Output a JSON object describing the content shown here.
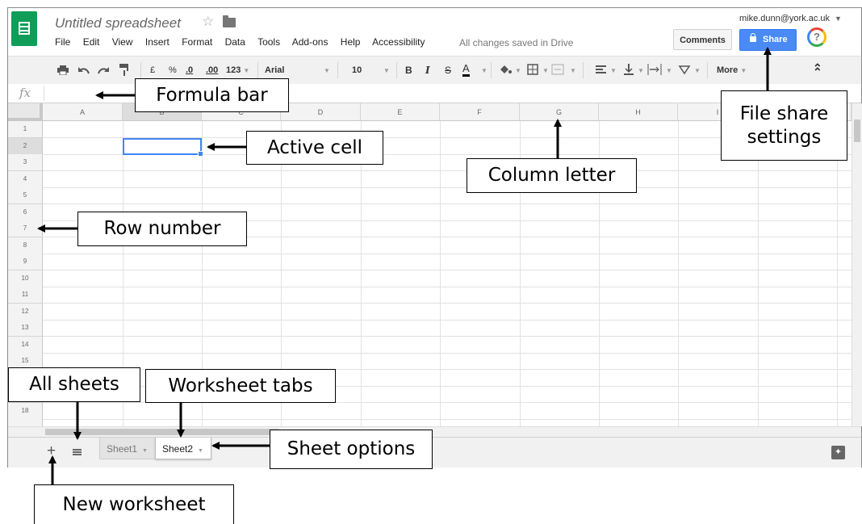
{
  "header": {
    "doc_title": "Untitled spreadsheet",
    "star_icon": "☆",
    "menu": [
      "File",
      "Edit",
      "View",
      "Insert",
      "Format",
      "Data",
      "Tools",
      "Add-ons",
      "Help",
      "Accessibility"
    ],
    "save_status": "All changes saved in Drive",
    "account": "mike.dunn@york.ac.uk",
    "comments_label": "Comments",
    "share_label": "Share",
    "help_glyph": "?"
  },
  "toolbar": {
    "currency": "£",
    "percent": "%",
    "decrease_decimals": ".0",
    "increase_decimals": ".00",
    "more_formats": "123",
    "font": "Arial",
    "font_size": "10",
    "bold": "B",
    "italic": "I",
    "strike": "S",
    "text_color": "A",
    "more": "More",
    "collapse": "⌃"
  },
  "formula_bar": {
    "fx": "fx"
  },
  "grid": {
    "columns": [
      "A",
      "B",
      "C",
      "D",
      "E",
      "F",
      "G",
      "H",
      "I"
    ],
    "rows": [
      "1",
      "2",
      "3",
      "4",
      "5",
      "6",
      "7",
      "8",
      "9",
      "10",
      "11",
      "12",
      "13",
      "14",
      "15",
      "18"
    ]
  },
  "sheets": {
    "add": "+",
    "tabs": [
      "Sheet1",
      "Sheet2"
    ]
  },
  "colors": {
    "share_blue": "#4a8af4",
    "logo_green": "#0f9d58",
    "active_cell": "#4285f4"
  },
  "annotations": {
    "formula_bar": "Formula bar",
    "active_cell": "Active cell",
    "row_number": "Row number",
    "column_letter": "Column letter",
    "file_share_1": "File share",
    "file_share_2": "settings",
    "all_sheets": "All sheets",
    "worksheet_tabs": "Worksheet tabs",
    "sheet_options": "Sheet options",
    "new_worksheet": "New worksheet"
  }
}
